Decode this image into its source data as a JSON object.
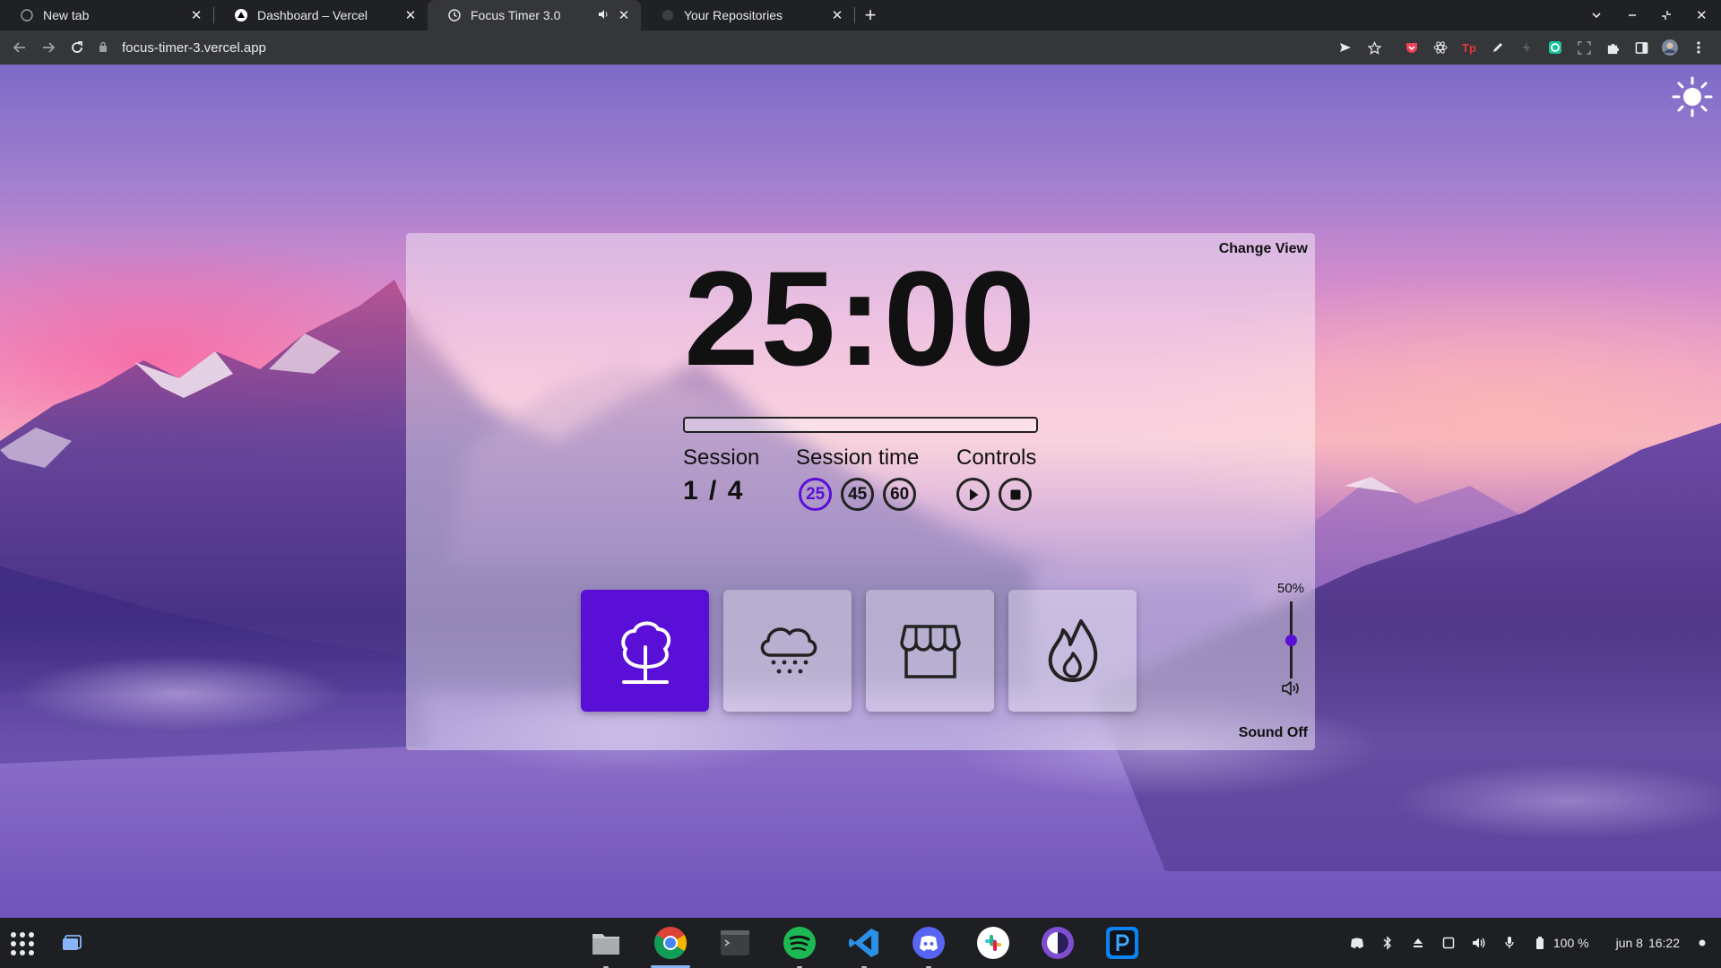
{
  "browser": {
    "tabs": [
      {
        "title": "New tab",
        "active": false,
        "favicon": "chrome-newtab-icon"
      },
      {
        "title": "Dashboard – Vercel",
        "active": false,
        "favicon": "vercel-triangle-icon"
      },
      {
        "title": "Focus Timer 3.0",
        "active": true,
        "favicon": "clock-icon",
        "audio": true
      },
      {
        "title": "Your Repositories",
        "active": false,
        "favicon": "github-icon"
      }
    ],
    "url": "focus-timer-3.vercel.app"
  },
  "app": {
    "change_view_label": "Change View",
    "timer": "25:00",
    "progress": 0,
    "session": {
      "label": "Session",
      "value": "1 / 4"
    },
    "session_time": {
      "label": "Session time",
      "options": [
        "25",
        "45",
        "60"
      ],
      "selected": "25"
    },
    "controls": {
      "label": "Controls",
      "buttons": [
        "play-icon",
        "stop-icon"
      ]
    },
    "sounds": [
      {
        "icon": "tree-icon",
        "active": true
      },
      {
        "icon": "rain-cloud-icon",
        "active": false
      },
      {
        "icon": "store-icon",
        "active": false
      },
      {
        "icon": "fire-icon",
        "active": false
      }
    ],
    "volume": {
      "label": "50%",
      "level": 0.5
    },
    "sound_off_label": "Sound Off"
  },
  "shelf": {
    "apps": [
      "files-icon",
      "chrome-icon",
      "terminal-icon",
      "spotify-icon",
      "vscode-icon",
      "discord-icon",
      "slack-icon",
      "tor-browser-icon",
      "pycharm-icon"
    ],
    "battery": "100 %",
    "date": "jun 8",
    "time": "16:22"
  },
  "colors": {
    "accent": "#5a0fd6",
    "chrome_dark": "#202124",
    "chrome_toolbar": "#35363a"
  }
}
